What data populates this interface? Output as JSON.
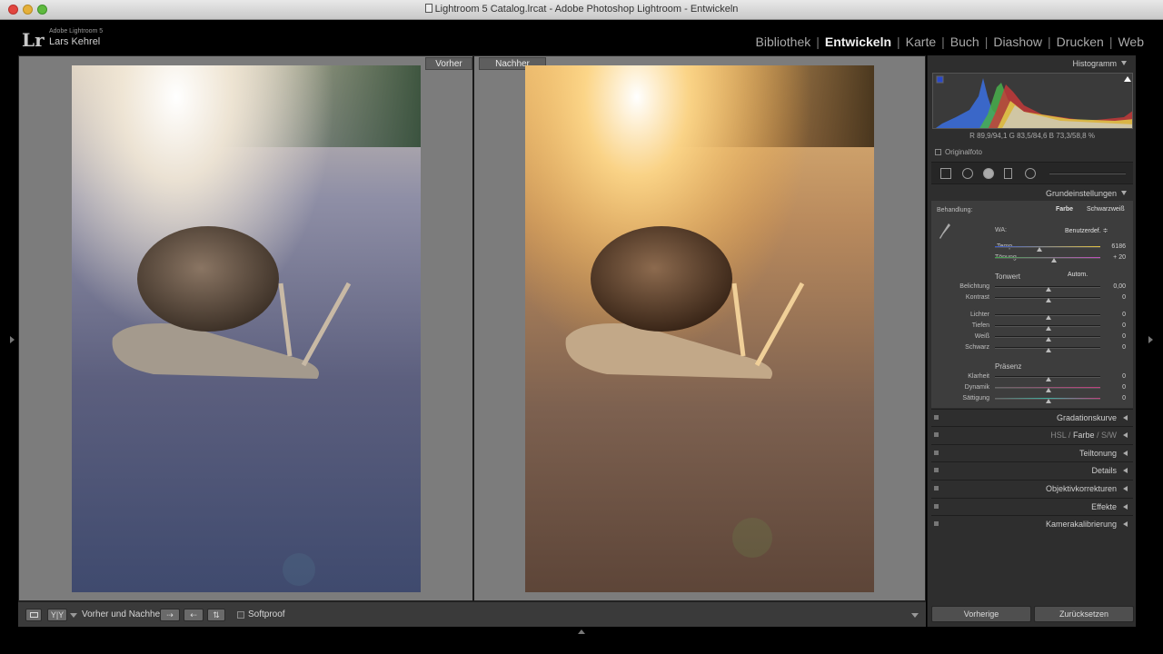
{
  "window": {
    "title": "Lightroom 5 Catalog.lrcat - Adobe Photoshop Lightroom - Entwickeln"
  },
  "identity": {
    "logo": "Lr",
    "product": "Adobe Lightroom 5",
    "user": "Lars Kehrel"
  },
  "modules": [
    "Bibliothek",
    "Entwickeln",
    "Karte",
    "Buch",
    "Diashow",
    "Drucken",
    "Web"
  ],
  "active_module": "Entwickeln",
  "view": {
    "before_label": "Vorher",
    "after_label": "Nachher"
  },
  "toolbar": {
    "view_btn": "Y|Y",
    "compare_label": "Vorher und Nachher:",
    "softproof_label": "Softproof"
  },
  "panel": {
    "histogram_title": "Histogramm",
    "rgb": "R  89,9/94,1   G  83,5/84,6   B  73,3/58,8  %",
    "original_photo": "Originalfoto",
    "basic_title": "Grundeinstellungen",
    "treatment_label": "Behandlung:",
    "treatment_color": "Farbe",
    "treatment_bw": "Schwarzweiß",
    "wb_label": "WA:",
    "wb_value": "Benutzerdef. ≑",
    "temp_label": "Temp.",
    "temp_value": "6186",
    "tint_label": "Tönung",
    "tint_value": "+ 20",
    "tone_title": "Tonwert",
    "auto_label": "Autom.",
    "exposure_label": "Belichtung",
    "exposure_value": "0,00",
    "contrast_label": "Kontrast",
    "contrast_value": "0",
    "highlights_label": "Lichter",
    "highlights_value": "0",
    "shadows_label": "Tiefen",
    "shadows_value": "0",
    "whites_label": "Weiß",
    "whites_value": "0",
    "blacks_label": "Schwarz",
    "blacks_value": "0",
    "presence_title": "Präsenz",
    "clarity_label": "Klarheit",
    "clarity_value": "0",
    "vibrance_label": "Dynamik",
    "vibrance_value": "0",
    "saturation_label": "Sättigung",
    "saturation_value": "0",
    "tone_curve": "Gradationskurve",
    "hsl_a": "HSL",
    "hsl_sep1": "/",
    "hsl_b": "Farbe",
    "hsl_sep2": "/",
    "hsl_c": "S/W",
    "split_toning": "Teiltonung",
    "details": "Details",
    "lens": "Objektivkorrekturen",
    "effects": "Effekte",
    "calibration": "Kamerakalibrierung",
    "previous_btn": "Vorherige",
    "reset_btn": "Zurücksetzen"
  },
  "colors": {
    "accent": "#f2f2f2",
    "panel": "#2e2e2e",
    "background": "#7c7c7c"
  }
}
